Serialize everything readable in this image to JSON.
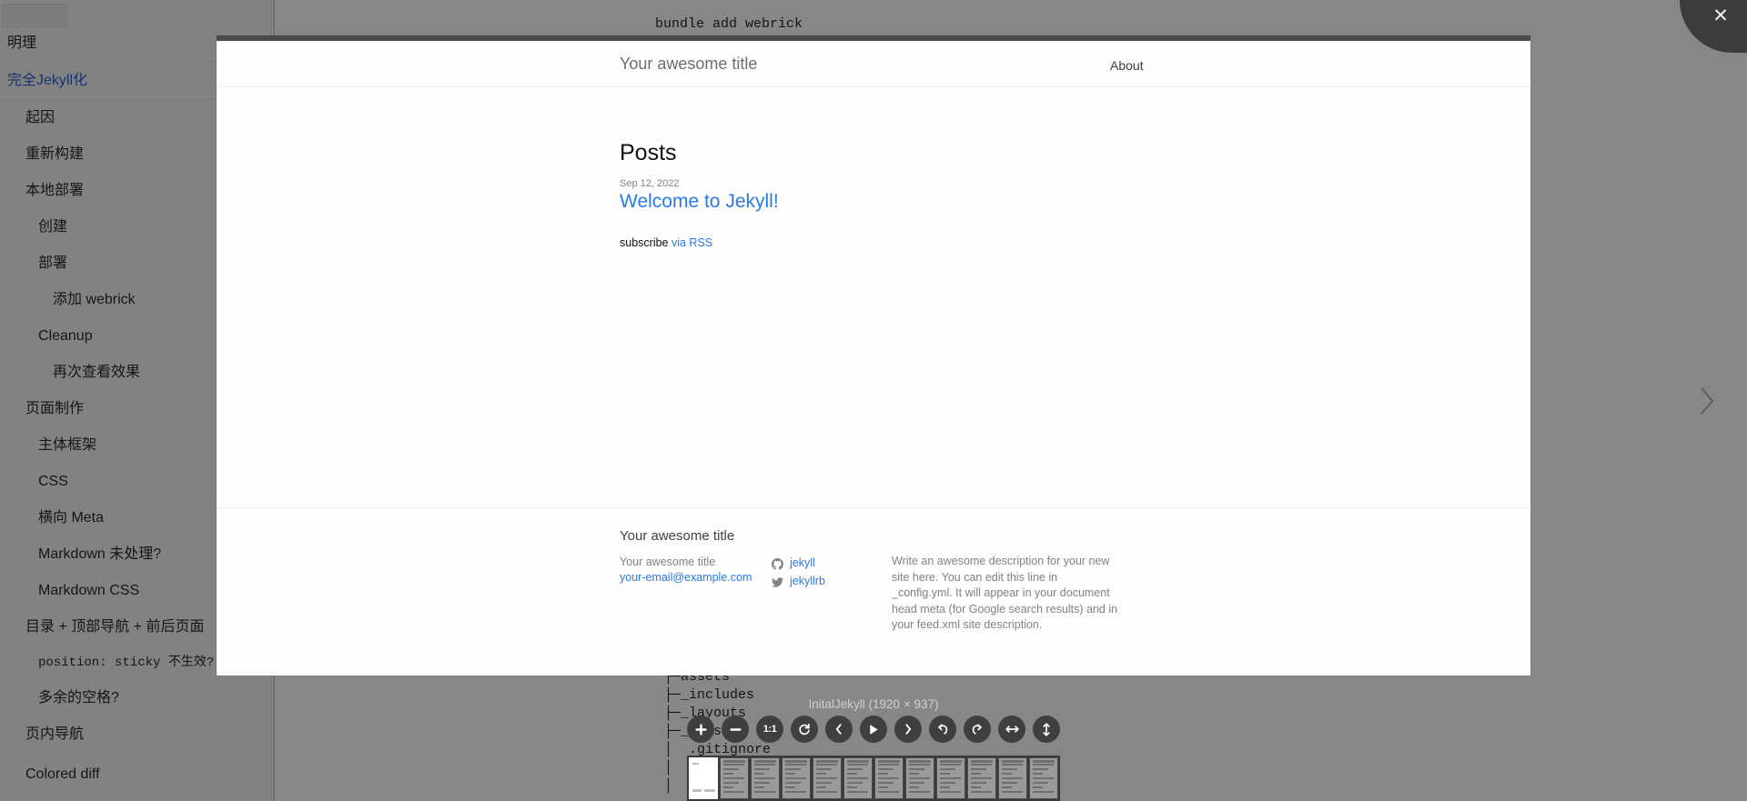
{
  "background": {
    "sidebar": {
      "items": [
        {
          "label": "明理",
          "level": 0,
          "link": false,
          "mono": false,
          "separator": true
        },
        {
          "label": "完全Jekyll化",
          "level": 0,
          "link": true,
          "mono": false,
          "separator": true
        },
        {
          "label": "起因",
          "level": 1,
          "link": false,
          "mono": false,
          "separator": false
        },
        {
          "label": "重新构建",
          "level": 1,
          "link": false,
          "mono": false,
          "separator": false
        },
        {
          "label": "本地部署",
          "level": 1,
          "link": false,
          "mono": false,
          "separator": false
        },
        {
          "label": "创建",
          "level": 2,
          "link": false,
          "mono": false,
          "separator": false
        },
        {
          "label": "部署",
          "level": 2,
          "link": false,
          "mono": false,
          "separator": false
        },
        {
          "label": "添加 webrick",
          "level": 3,
          "link": false,
          "mono": false,
          "separator": false
        },
        {
          "label": "Cleanup",
          "level": 2,
          "link": false,
          "mono": false,
          "separator": false
        },
        {
          "label": "再次查看效果",
          "level": 3,
          "link": false,
          "mono": false,
          "separator": false
        },
        {
          "label": "页面制作",
          "level": 1,
          "link": false,
          "mono": false,
          "separator": false
        },
        {
          "label": "主体框架",
          "level": 2,
          "link": false,
          "mono": false,
          "separator": false
        },
        {
          "label": "CSS",
          "level": 2,
          "link": false,
          "mono": false,
          "separator": false
        },
        {
          "label": "横向 Meta",
          "level": 2,
          "link": false,
          "mono": false,
          "separator": false
        },
        {
          "label": "Markdown 未处理?",
          "level": 2,
          "link": false,
          "mono": false,
          "separator": false
        },
        {
          "label": "Markdown CSS",
          "level": 2,
          "link": false,
          "mono": false,
          "separator": false
        },
        {
          "label": "目录 + 顶部导航 + 前后页面",
          "level": 1,
          "link": false,
          "mono": false,
          "separator": false
        },
        {
          "label": "position: sticky 不生效?",
          "level": 2,
          "link": false,
          "mono": true,
          "separator": false
        },
        {
          "label": "多余的空格?",
          "level": 2,
          "link": false,
          "mono": false,
          "separator": false
        },
        {
          "label": "页内导航",
          "level": 1,
          "link": false,
          "mono": false,
          "separator": false
        },
        {
          "label": "Colored diff",
          "level": 1,
          "link": false,
          "mono": false,
          "separator": false
        }
      ]
    },
    "command_text": "bundle add webrick",
    "file_tree": "├─assets\n├─_includes\n├─_layouts\n├─_sass\n│  .gitignore\n│  404.html\n│  Gemfile"
  },
  "lightbox": {
    "close_label": "✕",
    "next_label": "next-image",
    "caption": "InitalJekyll (1920 × 937)",
    "toolbar": [
      {
        "name": "zoom-in",
        "label": "✛"
      },
      {
        "name": "zoom-out",
        "label": "−"
      },
      {
        "name": "actual-size",
        "label": "1:1"
      },
      {
        "name": "reset",
        "label": "⟳"
      },
      {
        "name": "previous",
        "label": "‹"
      },
      {
        "name": "play-slideshow",
        "label": "▶"
      },
      {
        "name": "next",
        "label": "›"
      },
      {
        "name": "rotate-left",
        "label": "↰"
      },
      {
        "name": "rotate-right",
        "label": "↱"
      },
      {
        "name": "flip-horizontal",
        "label": "↔"
      },
      {
        "name": "flip-vertical",
        "label": "↕"
      }
    ],
    "thumbnails": [
      {
        "active": true
      },
      {
        "active": false
      },
      {
        "active": false
      },
      {
        "active": false
      },
      {
        "active": false
      },
      {
        "active": false
      },
      {
        "active": false
      },
      {
        "active": false
      },
      {
        "active": false
      },
      {
        "active": false
      },
      {
        "active": false
      },
      {
        "active": false
      }
    ]
  },
  "site": {
    "header": {
      "title": "Your awesome title",
      "nav_about": "About"
    },
    "main": {
      "posts_heading": "Posts",
      "post_date": "Sep 12, 2022",
      "post_title": "Welcome to Jekyll!",
      "subscribe_prefix": "subscribe ",
      "subscribe_link": "via RSS"
    },
    "footer": {
      "title": "Your awesome title",
      "owner": "Your awesome title",
      "email": "your-email@example.com",
      "social": [
        {
          "icon": "github-icon",
          "handle": "jekyll"
        },
        {
          "icon": "twitter-icon",
          "handle": "jekyllrb"
        }
      ],
      "description": "Write an awesome description for your new site here. You can edit this line in _config.yml. It will appear in your document head meta (for Google search results) and in your feed.xml site description."
    }
  },
  "colors": {
    "link": "#2a7ae2",
    "muted": "#828282",
    "overlay": "rgba(0,0,0,0.47)",
    "toolbar_button": "#3f3f3f"
  }
}
